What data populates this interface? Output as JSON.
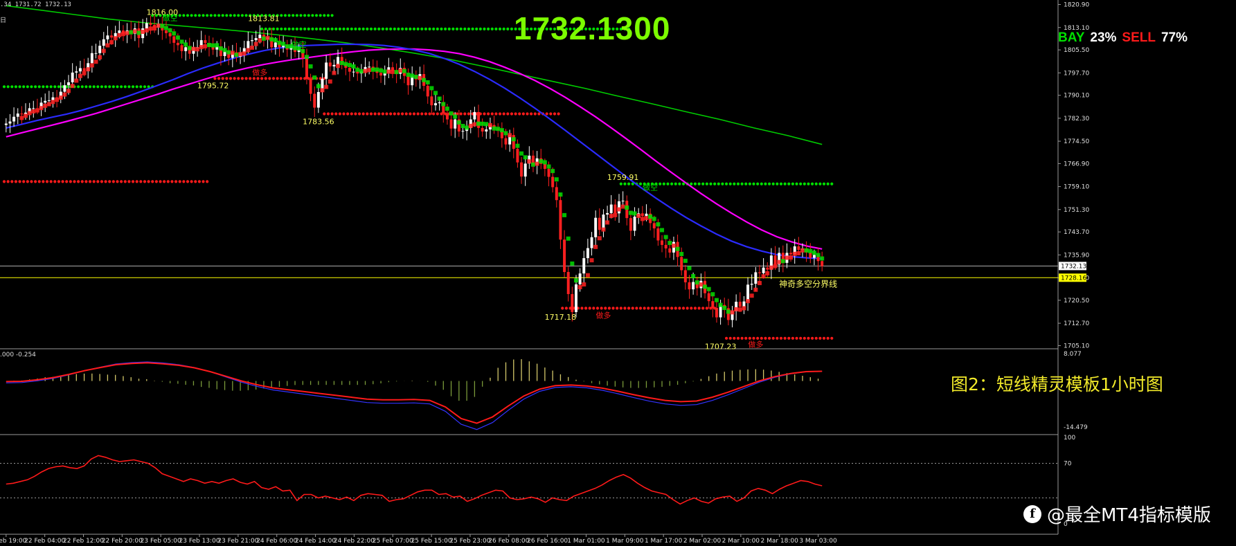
{
  "header": {
    "ticker_line": ".34 1731.72 1732.13",
    "timeframe_glyph": "日",
    "current_price_big": "1732.1300",
    "bay_label": "BAY",
    "bay_pct": "23%",
    "sell_label": "SELL",
    "sell_pct": "77%"
  },
  "captions": {
    "figure_caption": "图2：短线精灵模板1小时图",
    "watermark": "@最全MT4指标模版",
    "macd_label": ".000 -0.254"
  },
  "colors": {
    "bull_candle": "#ffffff",
    "bear_candle": "#ff2020",
    "green_dots": "#00e000",
    "red_dots": "#ff1a1a",
    "ma_green": "#00cc00",
    "ma_blue": "#2b2bff",
    "ma_magenta": "#ff00ff",
    "divider_line": "#ffff00",
    "annotation_text": "#ffff66"
  },
  "chart_data": {
    "type": "candlestick",
    "price_axis_ticks": [
      "1820.90",
      "1813.10",
      "1805.50",
      "1797.70",
      "1790.10",
      "1782.30",
      "1774.50",
      "1766.90",
      "1759.10",
      "1751.30",
      "1743.70",
      "1735.90",
      "1728.10",
      "1720.50",
      "1712.70",
      "1705.10"
    ],
    "price_range": [
      1704.5,
      1821.5
    ],
    "current_price_tag": "1732.13",
    "divider_price_tag": "1728.16",
    "divider_label": "神奇多空分界线",
    "time_labels": [
      "19 Feb 19:00",
      "22 Feb 04:00",
      "22 Feb 12:00",
      "22 Feb 20:00",
      "23 Feb 05:00",
      "23 Feb 13:00",
      "23 Feb 21:00",
      "24 Feb 06:00",
      "24 Feb 14:00",
      "24 Feb 22:00",
      "25 Feb 07:00",
      "25 Feb 15:00",
      "25 Feb 23:00",
      "26 Feb 08:00",
      "26 Feb 16:00",
      "1 Mar 01:00",
      "1 Mar 09:00",
      "1 Mar 17:00",
      "2 Mar 02:00",
      "2 Mar 10:00",
      "2 Mar 18:00",
      "3 Mar 03:00"
    ],
    "annotations": [
      {
        "text": "1816.00",
        "price": 1816.0,
        "bar": 40
      },
      {
        "text": "1813.81",
        "price": 1813.81,
        "bar": 66
      },
      {
        "text": "1795.72",
        "price": 1795.72,
        "bar": 53
      },
      {
        "text": "1783.56",
        "price": 1783.56,
        "bar": 80
      },
      {
        "text": "1759.91",
        "price": 1759.91,
        "bar": 158
      },
      {
        "text": "1717.18",
        "price": 1717.18,
        "bar": 142
      },
      {
        "text": "1707.23",
        "price": 1707.23,
        "bar": 183
      }
    ],
    "signal_tags": [
      {
        "text": "做空",
        "price": 1815.5,
        "bar": 42,
        "color": "#00e000"
      },
      {
        "text": "做空",
        "price": 1806.5,
        "bar": 75,
        "color": "#00e000"
      },
      {
        "text": "做多",
        "price": 1797.0,
        "bar": 65,
        "color": "#ff1a1a"
      },
      {
        "text": "做空",
        "price": 1758.0,
        "bar": 165,
        "color": "#00e000"
      },
      {
        "text": "做多",
        "price": 1714.5,
        "bar": 153,
        "color": "#ff1a1a"
      },
      {
        "text": "做多",
        "price": 1704.6,
        "bar": 192,
        "color": "#ff1a1a"
      }
    ],
    "dot_lines": [
      {
        "color": "green",
        "price": 1817.2,
        "from_bar": 38,
        "to_bar": 84
      },
      {
        "color": "green",
        "price": 1812.6,
        "from_bar": 66,
        "to_bar": 160
      },
      {
        "color": "green",
        "price": 1793.0,
        "from_bar": 0,
        "to_bar": 38
      },
      {
        "color": "green",
        "price": 1760.0,
        "from_bar": 158,
        "to_bar": 212
      },
      {
        "color": "red",
        "price": 1795.8,
        "from_bar": 54,
        "to_bar": 82
      },
      {
        "color": "red",
        "price": 1783.8,
        "from_bar": 82,
        "to_bar": 142
      },
      {
        "color": "red",
        "price": 1760.8,
        "from_bar": 0,
        "to_bar": 52
      },
      {
        "color": "red",
        "price": 1717.8,
        "from_bar": 143,
        "to_bar": 182
      },
      {
        "color": "red",
        "price": 1707.6,
        "from_bar": 185,
        "to_bar": 212
      }
    ],
    "series": [
      {
        "name": "close",
        "values": [
          1780.5,
          1781.2,
          1782.8,
          1783.9,
          1783.6,
          1784.2,
          1785.7,
          1785.7,
          1785.5,
          1787.6,
          1788.2,
          1788.4,
          1789.4,
          1789.2,
          1791.3,
          1793.5,
          1794.5,
          1797.8,
          1798.2,
          1799.3,
          1798.3,
          1801.0,
          1804.4,
          1804.4,
          1806.9,
          1809.1,
          1810.4,
          1809.7,
          1811.2,
          1812.1,
          1811.0,
          1812.1,
          1811.0,
          1812.8,
          1809.5,
          1812.8,
          1814.6,
          1814.0,
          1813.1,
          1814.2,
          1812.1,
          1811.2,
          1810.1,
          1807.9,
          1807.1,
          1805.1,
          1806.4,
          1804.2,
          1806.4,
          1806.4,
          1808.8,
          1807.8,
          1806.5,
          1805.6,
          1806.7,
          1803.4,
          1805.0,
          1802.8,
          1804.7,
          1803.2,
          1804.6,
          1806.1,
          1808.5,
          1808.8,
          1809.5,
          1810.7,
          1809.1,
          1809.8,
          1806.4,
          1808.0,
          1806.4,
          1807.1,
          1805.6,
          1806.6,
          1804.8,
          1805.8,
          1802.7,
          1795.6,
          1790.6,
          1785.9,
          1791.2,
          1795.7,
          1801.2,
          1799.9,
          1800.4,
          1803.1,
          1800.7,
          1799.4,
          1798.1,
          1798.1,
          1797.5,
          1798.2,
          1799.7,
          1799.8,
          1798.7,
          1797.7,
          1796.8,
          1797.7,
          1799.6,
          1798.4,
          1797.4,
          1799.4,
          1796.7,
          1793.5,
          1796.7,
          1795.5,
          1797.3,
          1793.3,
          1789.7,
          1786.7,
          1787.4,
          1787.7,
          1784.0,
          1781.9,
          1778.8,
          1781.9,
          1777.8,
          1778.0,
          1779.0,
          1781.9,
          1784.4,
          1779.0,
          1777.8,
          1778.5,
          1780.0,
          1778.8,
          1778.4,
          1775.5,
          1773.4,
          1776.6,
          1771.9,
          1767.3,
          1762.5,
          1766.9,
          1769.6,
          1766.5,
          1768.7,
          1766.8,
          1765.1,
          1762.4,
          1758.9,
          1754.5,
          1741.1,
          1730.1,
          1722.6,
          1716.5,
          1725.9,
          1729.6,
          1734.8,
          1738.2,
          1741.9,
          1748.5,
          1744.4,
          1749.6,
          1750.1,
          1753.0,
          1750.0,
          1754.1,
          1754.3,
          1748.4,
          1744.1,
          1748.9,
          1750.0,
          1749.1,
          1749.9,
          1746.7,
          1744.9,
          1740.8,
          1739.3,
          1738.1,
          1736.7,
          1740.3,
          1735.2,
          1730.7,
          1726.6,
          1724.2,
          1726.7,
          1724.6,
          1727.1,
          1722.9,
          1720.2,
          1717.9,
          1714.7,
          1718.9,
          1717.8,
          1713.8,
          1716.8,
          1720.0,
          1718.3,
          1720.1,
          1725.8,
          1726.1,
          1730.0,
          1729.7,
          1731.6,
          1730.9,
          1735.7,
          1732.6,
          1736.6,
          1733.2,
          1736.6,
          1736.1,
          1738.8,
          1737.6,
          1738.0,
          1736.7,
          1734.9,
          1735.9,
          1733.8,
          1732.1
        ]
      },
      {
        "name": "ma_green",
        "values": [
          1820.5,
          1819.0,
          1817.5,
          1816.0,
          1814.8,
          1813.8,
          1812.8,
          1811.8,
          1810.6,
          1809.3,
          1807.9,
          1806.2,
          1804.4,
          1802.4,
          1800.0,
          1797.5,
          1795.0,
          1792.5,
          1789.8,
          1787.2,
          1784.5,
          1781.9,
          1779.0,
          1776.4,
          1773.4
        ]
      },
      {
        "name": "ma_blue",
        "values": [
          1779.0,
          1780.2,
          1781.5,
          1782.6,
          1783.7,
          1785.0,
          1786.5,
          1788.0,
          1789.7,
          1791.5,
          1793.4,
          1795.3,
          1797.4,
          1799.3,
          1801.0,
          1802.6,
          1804.0,
          1805.2,
          1806.1,
          1806.7,
          1807.0,
          1807.2,
          1807.4,
          1807.4,
          1807.3,
          1807.0,
          1806.4,
          1805.5,
          1804.3,
          1802.6,
          1800.6,
          1798.2,
          1795.5,
          1792.5,
          1789.2,
          1785.7,
          1782.0,
          1778.2,
          1774.3,
          1770.4,
          1766.5,
          1762.6,
          1758.8,
          1755.2,
          1751.8,
          1748.6,
          1745.7,
          1743.0,
          1740.6,
          1738.7,
          1737.2,
          1736.0,
          1735.3,
          1734.9,
          1734.6
        ]
      },
      {
        "name": "ma_magenta",
        "values": [
          1776.0,
          1777.3,
          1778.6,
          1779.9,
          1781.2,
          1782.6,
          1784.0,
          1785.6,
          1787.2,
          1788.8,
          1790.4,
          1792.1,
          1793.7,
          1795.3,
          1796.8,
          1798.2,
          1799.4,
          1800.5,
          1801.4,
          1802.2,
          1802.9,
          1803.6,
          1804.3,
          1804.9,
          1805.4,
          1805.7,
          1805.8,
          1805.8,
          1805.5,
          1805.0,
          1804.2,
          1803.0,
          1801.5,
          1799.6,
          1797.5,
          1795.1,
          1792.4,
          1789.4,
          1786.2,
          1782.8,
          1779.2,
          1775.5,
          1771.7,
          1767.8,
          1764.0,
          1760.3,
          1756.7,
          1753.3,
          1750.1,
          1747.1,
          1744.4,
          1742.1,
          1740.3,
          1738.9,
          1737.9
        ]
      }
    ],
    "macd": {
      "range": [
        -14.479,
        8.077
      ],
      "top_label": "8.077",
      "bottom_label": "-14.479",
      "signal_values": [
        -0.2,
        -0.1,
        0.4,
        1.1,
        2.1,
        3.3,
        4.3,
        5.2,
        5.6,
        5.8,
        5.5,
        5.0,
        4.2,
        3.0,
        1.5,
        0.0,
        -1.2,
        -2.2,
        -2.8,
        -3.4,
        -4.0,
        -4.6,
        -5.2,
        -5.8,
        -6.0,
        -6.0,
        -5.9,
        -6.2,
        -8.3,
        -12.0,
        -13.5,
        -11.5,
        -8.0,
        -4.8,
        -2.6,
        -1.5,
        -1.3,
        -1.6,
        -2.3,
        -3.3,
        -4.4,
        -5.4,
        -6.2,
        -6.6,
        -6.4,
        -5.2,
        -3.6,
        -1.8,
        0.0,
        1.4,
        2.4,
        3.0,
        3.1
      ],
      "histogram_peak_bar": 156
    },
    "oscillator": {
      "range": [
        0,
        100
      ],
      "levels": [
        70,
        30
      ],
      "level_labels": [
        "100",
        "70",
        "0"
      ],
      "values": [
        46,
        47,
        49,
        51,
        55,
        60,
        64,
        66,
        67,
        65,
        64,
        67,
        75,
        79,
        77,
        74,
        72,
        73,
        74,
        72,
        70,
        65,
        58,
        55,
        52,
        49,
        52,
        50,
        47,
        49,
        47,
        50,
        52,
        48,
        46,
        49,
        42,
        40,
        43,
        38,
        39,
        27,
        34,
        34,
        30,
        32,
        30,
        28,
        31,
        27,
        33,
        35,
        34,
        33,
        26,
        28,
        29,
        33,
        37,
        39,
        39,
        34,
        35,
        31,
        32,
        26,
        29,
        33,
        36,
        39,
        38,
        30,
        28,
        29,
        31,
        29,
        25,
        30,
        28,
        27,
        32,
        35,
        38,
        41,
        45,
        50,
        54,
        57,
        53,
        47,
        42,
        38,
        36,
        34,
        28,
        23,
        27,
        30,
        26,
        24,
        29,
        31,
        32,
        26,
        30,
        38,
        41,
        39,
        35,
        40,
        44,
        47,
        50,
        49,
        46,
        44
      ]
    }
  }
}
